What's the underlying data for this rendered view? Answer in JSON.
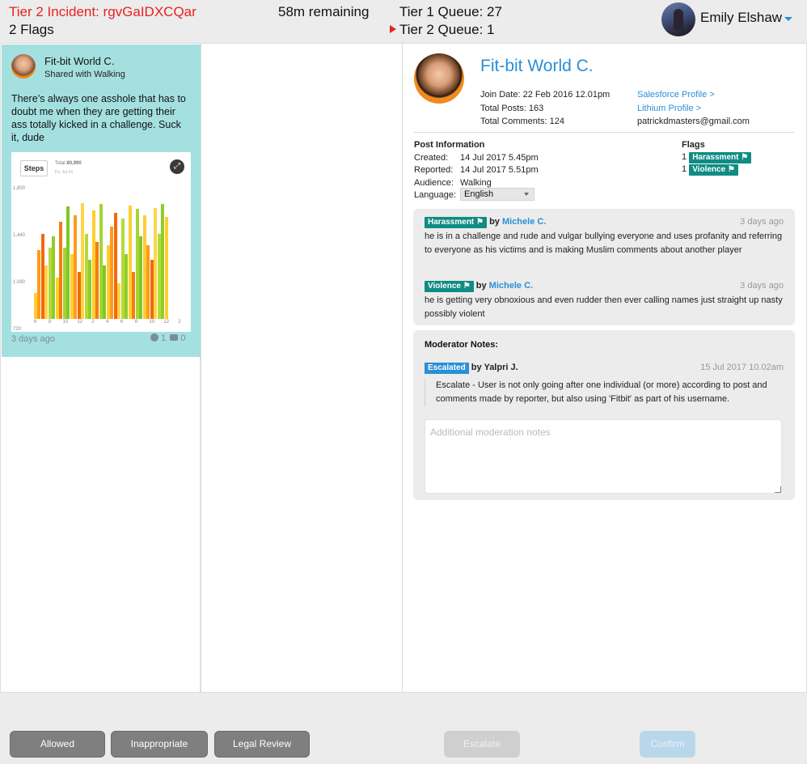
{
  "header": {
    "incident_title": "Tier 2 Incident: rgvGaIDXCQar",
    "flag_count": "2 Flags",
    "remaining": "58m remaining",
    "tier1_queue": "Tier 1 Queue: 27",
    "tier2_queue": "Tier 2 Queue: 1",
    "user_name": "Emily Elshaw"
  },
  "post": {
    "author": "Fit-bit World C.",
    "shared_with": "Shared with Walking",
    "text": "There’s always one asshole that has to doubt me when they are getting their ass totally kicked in a challenge. Suck it, dude",
    "time": "3 days ago",
    "reaction_count": "1",
    "comment_count": "0",
    "image": {
      "chip_label": "Steps",
      "total_label": "Total",
      "total_value": "80,990",
      "date_label": "Fri, Jul 14",
      "y_ticks": [
        "1,800",
        "1,440",
        "1,080",
        "720"
      ],
      "x_ticks": [
        "6",
        "8",
        "10",
        "12",
        "2",
        "4",
        "6",
        "8",
        "10",
        "12",
        "2"
      ],
      "bar_levels": [
        0.22,
        0.58,
        0.72,
        0.45,
        0.6,
        0.7,
        0.35,
        0.82,
        0.6,
        0.95,
        0.55,
        0.88,
        0.4,
        0.98,
        0.72,
        0.5,
        0.92,
        0.65,
        0.97,
        0.45,
        0.62,
        0.78,
        0.9,
        0.3,
        0.85,
        0.55,
        0.96,
        0.4,
        0.93,
        0.7,
        0.88,
        0.62,
        0.5,
        0.94,
        0.72,
        0.97,
        0.86
      ],
      "bar_colors": [
        "#ffcc33",
        "#ff9a1a",
        "#f26a0a",
        "#ffd44a",
        "#b6d93a",
        "#8fcd2a",
        "#ffcf2e",
        "#f57c12",
        "#a4d534",
        "#7fc826"
      ]
    }
  },
  "profile": {
    "name": "Fit-bit World C.",
    "join_date": "Join Date: 22 Feb 2016 12.01pm",
    "total_posts": "Total Posts: 163",
    "total_comments": "Total Comments: 124",
    "salesforce_link": "Salesforce Profile >",
    "lithium_link": "Lithium Profile >",
    "email": "patrickdmasters@gmail.com"
  },
  "post_info": {
    "heading": "Post Information",
    "created_label": "Created:",
    "created_value": "14 Jul 2017 5.45pm",
    "reported_label": "Reported:",
    "reported_value": "14 Jul 2017 5.51pm",
    "audience_label": "Audience:",
    "audience_value": "Walking",
    "language_label": "Language:",
    "language_value": "English"
  },
  "flags": {
    "heading": "Flags",
    "items": [
      {
        "count": "1",
        "label": "Harassment ⚑"
      },
      {
        "count": "1",
        "label": "Violence ⚑"
      }
    ]
  },
  "reports": [
    {
      "tag": "Harassment ⚑",
      "by": "by",
      "reporter": "Michele C.",
      "ago": "3 days ago",
      "text": "he is in a challenge and rude and vulgar bullying everyone and uses profanity and referring to everyone as his victims and is making Muslim comments about another player"
    },
    {
      "tag": "Violence ⚑",
      "by": "by",
      "reporter": "Michele C.",
      "ago": "3 days ago",
      "text": "he is getting very obnoxious and even rudder then ever calling names just straight up nasty possibly violent"
    }
  ],
  "notes": {
    "title": "Moderator Notes:",
    "status_tag": "Escalated",
    "by": "by Yalpri J.",
    "date": "15 Jul 2017 10.02am",
    "body": "Escalate - User is not only going after one individual (or more) according to post and comments made by reporter, but also using 'Fitbit' as part of his username.",
    "placeholder": "Additional moderation notes"
  },
  "actions": {
    "allowed": "Allowed",
    "inappropriate": "Inappropriate",
    "legal_review": "Legal Review",
    "escalate": "Escalate",
    "confirm": "Confirm"
  },
  "colors": {
    "accent": "#2a8fd6",
    "incident": "#e8211f",
    "flag_tag": "#0f8c83",
    "post_card": "#a5e0e0"
  }
}
